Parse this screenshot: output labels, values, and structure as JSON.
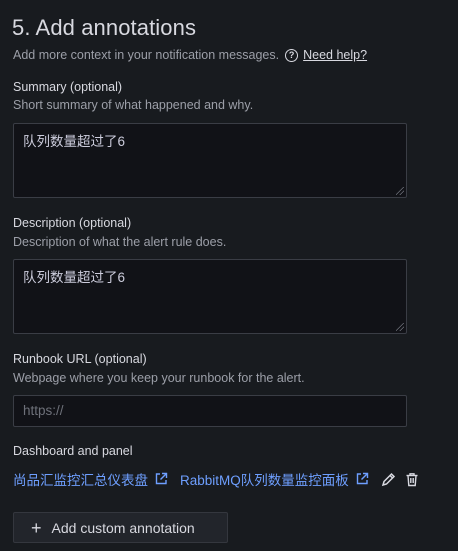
{
  "section": {
    "title": "5. Add annotations",
    "subtitle": "Add more context in your notification messages.",
    "help_link": "Need help?",
    "help_icon": "?"
  },
  "summary": {
    "label": "Summary (optional)",
    "description": "Short summary of what happened and why.",
    "value": "队列数量超过了6"
  },
  "description_field": {
    "label": "Description (optional)",
    "description": "Description of what the alert rule does.",
    "value": "队列数量超过了6"
  },
  "runbook": {
    "label": "Runbook URL (optional)",
    "description": "Webpage where you keep your runbook for the alert.",
    "placeholder": "https://"
  },
  "dashboard_panel": {
    "label": "Dashboard and panel",
    "dashboard_link": "尚品汇监控汇总仪表盘",
    "panel_link": "RabbitMQ队列数量监控面板",
    "icons": [
      "external-link-icon",
      "pencil-icon",
      "trash-icon"
    ]
  },
  "add_button": {
    "label": "Add custom annotation",
    "icon": "+"
  },
  "colors": {
    "background": "#181b1f",
    "link": "#6e9fff",
    "input_bg": "#111217"
  }
}
